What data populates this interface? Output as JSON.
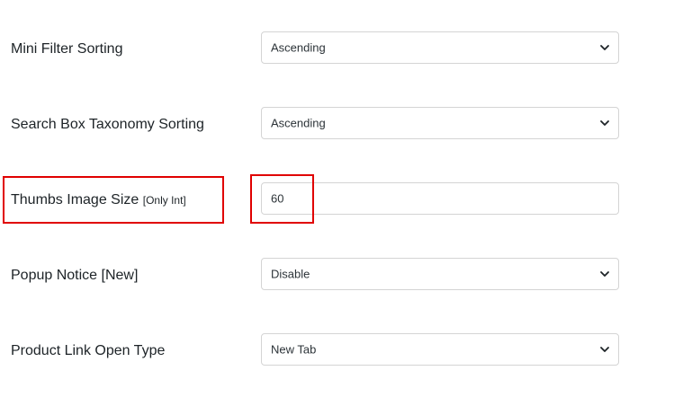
{
  "settings": [
    {
      "label": "Mini Filter Sorting",
      "type": "select",
      "value": "Ascending"
    },
    {
      "label": "Search Box Taxonomy Sorting",
      "type": "select",
      "value": "Ascending"
    },
    {
      "label": "Thumbs Image Size",
      "label_suffix": "[Only Int]",
      "type": "input",
      "value": "60"
    },
    {
      "label": "Popup Notice [New]",
      "type": "select",
      "value": "Disable"
    },
    {
      "label": "Product Link Open Type",
      "type": "select",
      "value": "New Tab"
    }
  ],
  "icons": {
    "dropdown": "chevron-down-icon"
  },
  "colors": {
    "highlight": "#e00000",
    "border": "#d4d4d4"
  }
}
